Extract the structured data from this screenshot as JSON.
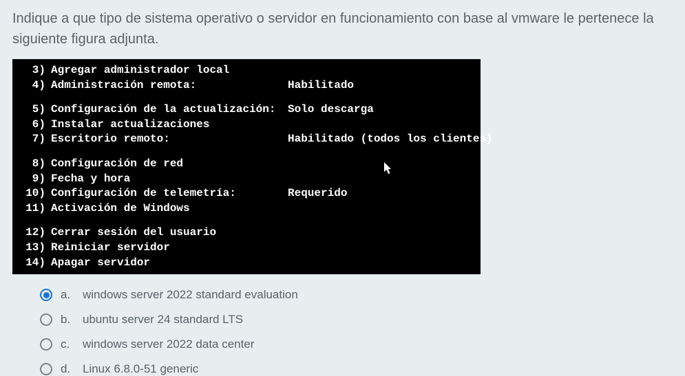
{
  "question": "Indique a que tipo de sistema operativo o servidor en funcionamiento con base al vmware le pertenece la siguiente figura adjunta.",
  "terminal": {
    "rows": [
      {
        "n": "3)",
        "label": "Agregar administrador local",
        "value": ""
      },
      {
        "n": "4)",
        "label": "Administración remota:",
        "value": "Habilitado"
      }
    ],
    "rows2": [
      {
        "n": "5)",
        "label": "Configuración de la actualización:",
        "value": "Solo descarga"
      },
      {
        "n": "6)",
        "label": "Instalar actualizaciones",
        "value": ""
      },
      {
        "n": "7)",
        "label": "Escritorio remoto:",
        "value": "Habilitado (todos los clientes)"
      }
    ],
    "rows3": [
      {
        "n": "8)",
        "label": "Configuración de red",
        "value": ""
      },
      {
        "n": "9)",
        "label": "Fecha y hora",
        "value": ""
      },
      {
        "n": "10)",
        "label": "Configuración de telemetría:",
        "value": "Requerido"
      },
      {
        "n": "11)",
        "label": "Activación de Windows",
        "value": ""
      }
    ],
    "rows4": [
      {
        "n": "12)",
        "label": "Cerrar sesión del usuario",
        "value": ""
      },
      {
        "n": "13)",
        "label": "Reiniciar servidor",
        "value": ""
      },
      {
        "n": "14)",
        "label": "Apagar servidor",
        "value": ""
      }
    ]
  },
  "options": [
    {
      "letter": "a.",
      "text": "windows server 2022 standard evaluation",
      "selected": true
    },
    {
      "letter": "b.",
      "text": "ubuntu server 24 standard LTS",
      "selected": false
    },
    {
      "letter": "c.",
      "text": "windows server 2022 data center",
      "selected": false
    },
    {
      "letter": "d.",
      "text": "Linux 6.8.0-51 generic",
      "selected": false
    }
  ]
}
